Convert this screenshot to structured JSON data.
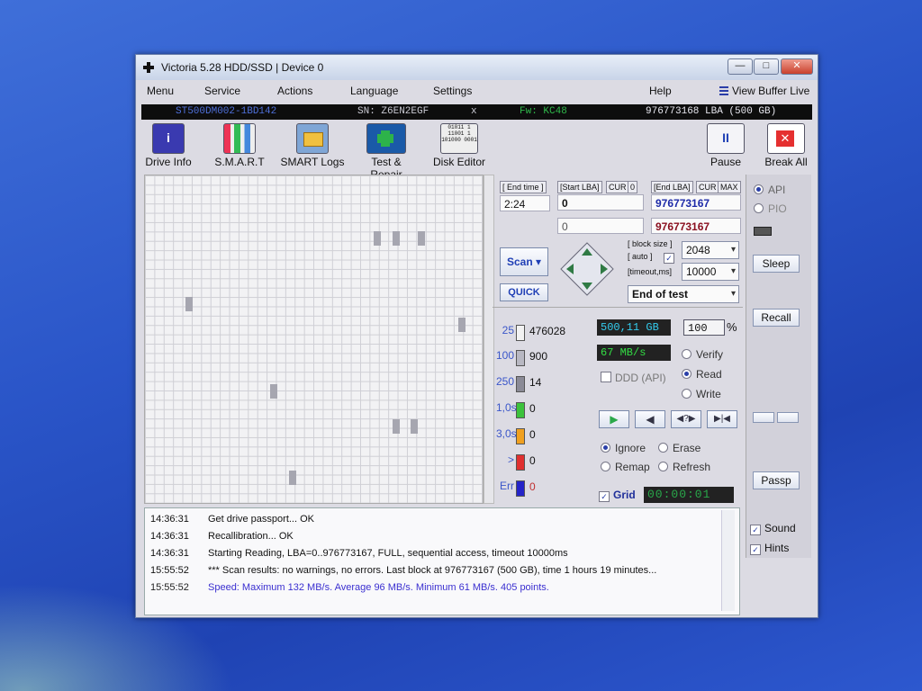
{
  "window": {
    "title": "Victoria 5.28 HDD/SSD | Device 0",
    "min_label": "—",
    "max_label": "□",
    "close_label": "✕"
  },
  "menu": {
    "items": [
      "Menu",
      "Service",
      "Actions",
      "Language",
      "Settings",
      "Help"
    ],
    "view_buffer_live": "View Buffer Live"
  },
  "device": {
    "model": "ST500DM002-1BD142",
    "serial": "SN: Z6EN2EGF",
    "x": "x",
    "firmware": "Fw: KC48",
    "capacity": "976773168 LBA (500 GB)"
  },
  "toolbar": {
    "drive_info": "Drive Info",
    "drive_info_glyph": "i",
    "smart": "S.M.A.R.T",
    "smart_logs": "SMART Logs",
    "test_repair": "Test & Repair",
    "disk_editor": "Disk Editor",
    "disk_editor_glyph": "01011 1 11001 1 101000 0001",
    "pause": "Pause",
    "pause_glyph": "II",
    "break_all": "Break All",
    "break_glyph": "✕"
  },
  "scan": {
    "end_time_label": "[ End time ]",
    "end_time": "2:24",
    "start_lba_label": "[Start LBA]",
    "cur_label": "CUR",
    "start_cur_value": "0",
    "start_lba": "0",
    "start_lba_2": "0",
    "end_lba_label": "[End LBA]",
    "end_cur": "CUR",
    "max_label": "MAX",
    "end_lba": "976773167",
    "end_lba_2": "976773167",
    "scan_button": "Scan",
    "quick_button": "QUICK",
    "block_size_label": "[ block size ]",
    "auto_label": "[ auto ]",
    "block_size": "2048",
    "timeout_label": "[timeout,ms]",
    "timeout": "10000",
    "end_mode": "End of test"
  },
  "legend": [
    {
      "label": "25",
      "count": "476028",
      "color": "#f2f2f2"
    },
    {
      "label": "100",
      "count": "900",
      "color": "#b8b8c2"
    },
    {
      "label": "250",
      "count": "14",
      "color": "#8a8a96"
    },
    {
      "label": "1,0s",
      "count": "0",
      "color": "#3cc23c"
    },
    {
      "label": "3,0s",
      "count": "0",
      "color": "#f0a020"
    },
    {
      "label": ">",
      "count": "0",
      "color": "#e03030"
    },
    {
      "label": "Err",
      "count": "0",
      "color": "#2424c8"
    }
  ],
  "stats": {
    "size": "500,11 GB",
    "percent": "100",
    "percent_unit": "%",
    "speed": "67 MB/s",
    "ddd": "DDD (API)"
  },
  "mode": {
    "verify": "Verify",
    "read": "Read",
    "write": "Write",
    "selected": "Read"
  },
  "action": {
    "ignore": "Ignore",
    "erase": "Erase",
    "remap": "Remap",
    "refresh": "Refresh",
    "selected": "Ignore"
  },
  "grid_label": "Grid",
  "timer": "00:00:01",
  "sidebar": {
    "api": "API",
    "pio": "PIO",
    "sleep": "Sleep",
    "recall": "Recall",
    "passp": "Passp",
    "sound": "Sound",
    "hints": "Hints"
  },
  "log": [
    {
      "time": "14:36:31",
      "msg": "Get drive passport... OK",
      "color": "#222"
    },
    {
      "time": "14:36:31",
      "msg": "Recallibration... OK",
      "color": "#222"
    },
    {
      "time": "14:36:31",
      "msg": "Starting Reading, LBA=0..976773167, FULL, sequential access, timeout 10000ms",
      "color": "#222"
    },
    {
      "time": "15:55:52",
      "msg": "*** Scan results: no warnings, no errors. Last block at 976773167 (500 GB), time 1 hours 19 minutes...",
      "color": "#222"
    },
    {
      "time": "15:55:52",
      "msg": "Speed: Maximum 132 MB/s. Average 96 MB/s. Minimum 61 MB/s. 405 points.",
      "color": "#3a2fd0"
    }
  ],
  "colors": {
    "lba_blue": "#1d2aa8",
    "lba_red": "#8a1020",
    "size_cyan": "#33ccee",
    "speed_green": "#33dd44",
    "timer_green": "#29a84a"
  }
}
